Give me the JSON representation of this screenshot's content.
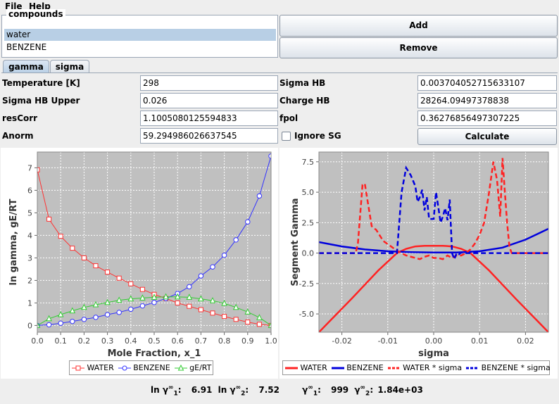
{
  "menu": {
    "file": "File",
    "help": "Help"
  },
  "compounds": {
    "title": "compounds",
    "items": [
      "water",
      "BENZENE"
    ],
    "selected": 0
  },
  "buttons": {
    "add": "Add",
    "remove": "Remove",
    "calculate": "Calculate"
  },
  "tabs": [
    {
      "label": "gamma",
      "active": true
    },
    {
      "label": "sigma",
      "active": false
    }
  ],
  "params": {
    "temperature_label": "Temperature [K]",
    "temperature": "298",
    "sigma_hb_label": "Sigma HB",
    "sigma_hb": "0.003704052715633107",
    "sigma_hb_upper_label": "Sigma HB Upper",
    "sigma_hb_upper": "0.026",
    "charge_hb_label": "Charge HB",
    "charge_hb": "28264.09497378838",
    "rescorr_label": "resCorr",
    "rescorr": "1.1005080125594833",
    "fpol_label": "fpol",
    "fpol": "0.36276856497307225",
    "anorm_label": "Anorm",
    "anorm": "59.294986026637545",
    "ignore_sg_label": "Ignore SG",
    "ignore_sg": false
  },
  "colors": {
    "red": "#ff3333",
    "blue": "#3333ff",
    "green": "#33cc33",
    "plot_bg": "#c0c0c0"
  },
  "chart_data": [
    {
      "type": "line",
      "xlabel": "Mole Fraction, x_1",
      "ylabel": "ln gamma, gE/RT",
      "xlim": [
        0,
        1
      ],
      "ylim": [
        -0.3,
        7.7
      ],
      "xticks": [
        "0.0",
        "0.1",
        "0.2",
        "0.3",
        "0.4",
        "0.5",
        "0.6",
        "0.7",
        "0.8",
        "0.9",
        "1.0"
      ],
      "yticks": [
        "0",
        "1",
        "2",
        "3",
        "4",
        "5",
        "6",
        "7"
      ],
      "grid": true,
      "legend_position": "bottom",
      "x": [
        0,
        0.05,
        0.1,
        0.15,
        0.2,
        0.25,
        0.3,
        0.35,
        0.4,
        0.45,
        0.5,
        0.55,
        0.6,
        0.65,
        0.7,
        0.75,
        0.8,
        0.85,
        0.9,
        0.95,
        1.0
      ],
      "series": [
        {
          "name": "WATER",
          "color": "#ff3333",
          "marker": "square",
          "values": [
            6.91,
            4.72,
            3.96,
            3.43,
            3.0,
            2.65,
            2.37,
            2.1,
            1.85,
            1.6,
            1.38,
            1.2,
            1.0,
            0.85,
            0.7,
            0.55,
            0.4,
            0.27,
            0.15,
            0.05,
            0.0
          ]
        },
        {
          "name": "BENZENE",
          "color": "#3333ff",
          "marker": "circle",
          "values": [
            0.0,
            0.03,
            0.1,
            0.18,
            0.27,
            0.36,
            0.48,
            0.58,
            0.72,
            0.87,
            1.02,
            1.2,
            1.42,
            1.72,
            2.2,
            2.6,
            3.12,
            3.8,
            4.6,
            5.75,
            7.52
          ]
        },
        {
          "name": "gE/RT",
          "color": "#33cc33",
          "marker": "triangle",
          "values": [
            0.0,
            0.3,
            0.48,
            0.65,
            0.8,
            0.92,
            1.02,
            1.12,
            1.18,
            1.22,
            1.25,
            1.27,
            1.27,
            1.25,
            1.18,
            1.1,
            0.98,
            0.8,
            0.6,
            0.35,
            0.0
          ]
        }
      ]
    },
    {
      "type": "line",
      "xlabel": "sigma",
      "ylabel": "Segment Gamma",
      "xlim": [
        -0.025,
        0.025
      ],
      "ylim": [
        -6.5,
        8.3
      ],
      "xticks": [
        "-0.02",
        "-0.01",
        "0.00",
        "0.01",
        "0.02"
      ],
      "yticks": [
        "-5.0",
        "-2.5",
        "0.0",
        "2.5",
        "5.0",
        "7.5"
      ],
      "grid": true,
      "legend_position": "bottom",
      "series": [
        {
          "name": "WATER",
          "color": "#ff2222",
          "dash": false,
          "x": [
            -0.025,
            -0.018,
            -0.012,
            -0.008,
            -0.006,
            -0.004,
            -0.002,
            0.0,
            0.002,
            0.004,
            0.006,
            0.008,
            0.012,
            0.018,
            0.025
          ],
          "values": [
            -6.5,
            -3.8,
            -1.4,
            0.0,
            0.35,
            0.55,
            0.6,
            0.6,
            0.6,
            0.55,
            0.35,
            0.0,
            -1.4,
            -3.8,
            -6.5
          ]
        },
        {
          "name": "BENZENE",
          "color": "#0000dd",
          "dash": false,
          "x": [
            -0.025,
            -0.02,
            -0.015,
            -0.01,
            -0.005,
            0.0,
            0.005,
            0.01,
            0.015,
            0.02,
            0.025
          ],
          "values": [
            0.9,
            0.55,
            0.3,
            0.15,
            0.08,
            0.05,
            0.05,
            0.15,
            0.45,
            1.1,
            2.0
          ]
        },
        {
          "name": "WATER * sigma",
          "color": "#ff2222",
          "dash": true,
          "x": [
            -0.025,
            -0.017,
            -0.0165,
            -0.0155,
            -0.015,
            -0.0145,
            -0.0135,
            -0.0125,
            -0.011,
            -0.0095,
            -0.008,
            -0.006,
            -0.004,
            -0.003,
            -0.002,
            -0.001,
            0.0,
            0.001,
            0.002,
            0.003,
            0.004,
            0.005,
            0.006,
            0.007,
            0.008,
            0.009,
            0.01,
            0.011,
            0.012,
            0.013,
            0.0138,
            0.0145,
            0.015,
            0.0155,
            0.016,
            0.0165,
            0.017,
            0.018,
            0.025
          ],
          "values": [
            0.0,
            0.0,
            0.8,
            5.6,
            5.7,
            4.5,
            2.2,
            1.9,
            1.0,
            0.6,
            0.2,
            -0.2,
            -0.4,
            -0.5,
            -0.3,
            -0.2,
            -0.4,
            -0.4,
            -0.5,
            -0.2,
            -0.4,
            -0.2,
            -0.2,
            0.0,
            0.3,
            0.8,
            1.5,
            2.5,
            4.8,
            7.5,
            6.0,
            3.0,
            7.8,
            5.0,
            2.5,
            0.5,
            0.0,
            0.0,
            0.0
          ]
        },
        {
          "name": "BENZENE * sigma",
          "color": "#0000dd",
          "dash": true,
          "x": [
            -0.025,
            -0.008,
            -0.007,
            -0.006,
            -0.005,
            -0.004,
            -0.0035,
            -0.003,
            -0.0025,
            -0.002,
            -0.0015,
            -0.001,
            0.0,
            0.0005,
            0.001,
            0.0015,
            0.002,
            0.0025,
            0.003,
            0.0035,
            0.004,
            0.0045,
            0.005,
            0.0055,
            0.006,
            0.007,
            0.008,
            0.009,
            0.01,
            0.025
          ],
          "values": [
            0.0,
            0.0,
            5.0,
            7.0,
            6.4,
            5.5,
            4.2,
            4.6,
            5.2,
            3.5,
            4.6,
            2.8,
            2.8,
            5.0,
            3.8,
            2.5,
            3.0,
            3.7,
            2.7,
            4.4,
            0.0,
            -0.5,
            0.0,
            -0.1,
            0.05,
            0.0,
            0.0,
            0.0,
            0.0,
            0.0
          ]
        }
      ]
    }
  ],
  "status": {
    "ln_g1_label": "ln γ",
    "ln_g1_sub": "1",
    "ln_g1": "6.91",
    "ln_g2_label": "ln γ",
    "ln_g2_sub": "2",
    "ln_g2": "7.52",
    "g1_label": "γ",
    "g1_sub": "1",
    "g1": "999",
    "g2_label": "γ",
    "g2_sub": "2",
    "g2": "1.84e+03",
    "sup": "∞"
  }
}
